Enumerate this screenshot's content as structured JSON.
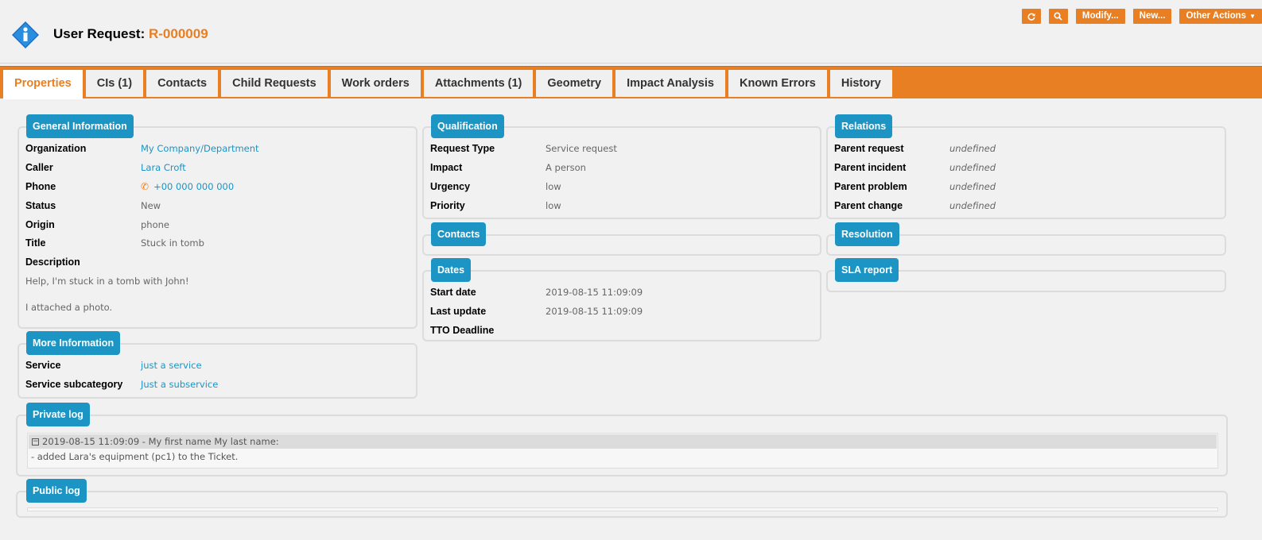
{
  "header": {
    "title_prefix": "User Request: ",
    "ref": "R-000009",
    "icon": "info-icon",
    "actions": {
      "refresh_icon": "refresh-icon",
      "search_icon": "search-icon",
      "modify": "Modify...",
      "new": "New...",
      "other": "Other Actions"
    }
  },
  "tabs": [
    "Properties",
    "CIs (1)",
    "Contacts",
    "Child Requests",
    "Work orders",
    "Attachments (1)",
    "Geometry",
    "Impact Analysis",
    "Known Errors",
    "History"
  ],
  "general": {
    "legend": "General Information",
    "organization_label": "Organization",
    "organization": "My Company/Department",
    "caller_label": "Caller",
    "caller": "Lara Croft",
    "phone_label": "Phone",
    "phone": "+00 000 000 000",
    "status_label": "Status",
    "status": "New",
    "origin_label": "Origin",
    "origin": "phone",
    "title_label": "Title",
    "title": "Stuck in tomb",
    "description_label": "Description",
    "description_line1": "Help, I'm stuck in a tomb with John!",
    "description_line2": "I attached a photo."
  },
  "more": {
    "legend": "More Information",
    "service_label": "Service",
    "service": "just a service",
    "subcategory_label": "Service subcategory",
    "subcategory": "Just a subservice"
  },
  "qualification": {
    "legend": "Qualification",
    "request_type_label": "Request Type",
    "request_type": "Service request",
    "impact_label": "Impact",
    "impact": "A person",
    "urgency_label": "Urgency",
    "urgency": "low",
    "priority_label": "Priority",
    "priority": "low"
  },
  "contacts": {
    "legend": "Contacts"
  },
  "dates": {
    "legend": "Dates",
    "start_label": "Start date",
    "start": "2019-08-15 11:09:09",
    "update_label": "Last update",
    "update": "2019-08-15 11:09:09",
    "tto_label": "TTO Deadline"
  },
  "relations": {
    "legend": "Relations",
    "parent_request_label": "Parent request",
    "parent_request": "undefined",
    "parent_incident_label": "Parent incident",
    "parent_incident": "undefined",
    "parent_problem_label": "Parent problem",
    "parent_problem": "undefined",
    "parent_change_label": "Parent change",
    "parent_change": "undefined"
  },
  "resolution": {
    "legend": "Resolution"
  },
  "sla": {
    "legend": "SLA report"
  },
  "private_log": {
    "legend": "Private log",
    "entry_header": "2019-08-15 11:09:09 - My first name My last name:",
    "entry_body": "- added Lara's equipment (pc1) to the Ticket."
  },
  "public_log": {
    "legend": "Public log"
  },
  "colors": {
    "accent": "#e87f22",
    "legend": "#1c94c4"
  }
}
